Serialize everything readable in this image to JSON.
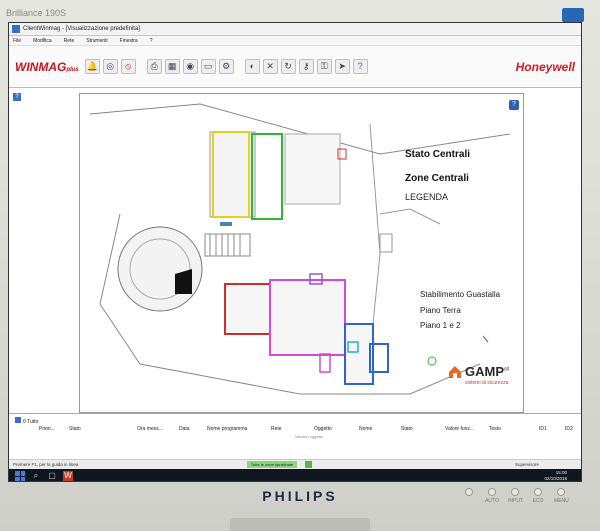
{
  "bezel": {
    "brand_top": "Brilliance 190S",
    "brand_bottom": "PHILIPS",
    "buttons": [
      "",
      "AUTO",
      "INPUT",
      "ECO",
      "MENU"
    ]
  },
  "window": {
    "title": "ClientWinmag - [Visualizzazione predefinita]"
  },
  "menu": {
    "items": [
      "File",
      "Modifica",
      "Rete",
      "Strumenti",
      "Finestra",
      "?"
    ]
  },
  "toolbar": {
    "app_logo": "WINMAG",
    "app_logo_suffix": "plus",
    "vendor": "Honeywell",
    "icons": [
      "alarm-bell-icon",
      "radar-icon",
      "no-entry-icon",
      "printer-icon",
      "map-icon",
      "camera-icon",
      "monitor-icon",
      "settings-icon",
      "gauge-icon",
      "settings-tools-icon",
      "refresh-icon",
      "key-icon",
      "lock-icon",
      "arrow-icon",
      "help-icon"
    ]
  },
  "legend": {
    "title": "Stato Centrali",
    "subtitle": "Zone Centrali",
    "label": "LEGENDA"
  },
  "site": {
    "name": "Stabilimento Guastalla",
    "floor_ground": "Piano Terra",
    "floor_upper": "Piano 1 e 2"
  },
  "brand": {
    "name": "GAMP",
    "suffix": "srl",
    "tagline": "sistemi di sicurezza"
  },
  "events": {
    "tab_label": "0 Tutto",
    "columns": [
      "Priori...",
      "Stato",
      "Ora mess...",
      "Data",
      "Nome programma",
      "Rete",
      "Oggetto",
      "Nome",
      "Stato",
      "Valore funz...",
      "Testo",
      "ID1",
      "ID2"
    ],
    "empty_text": "Nessun oggetto"
  },
  "statusbar": {
    "help": "Premere F1, per la guida in linea",
    "center": "Tutte le zone ripristinate",
    "user": "Supervisore"
  },
  "taskbar": {
    "time": "15:00",
    "date": "02/10/2018"
  }
}
